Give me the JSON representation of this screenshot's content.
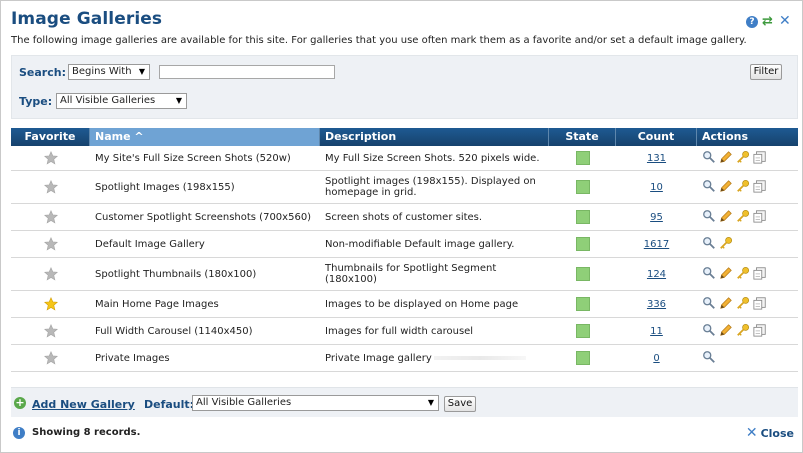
{
  "header": {
    "title": "Image Galleries",
    "subtitle": "The following image galleries are available for this site. For galleries that you use often mark them as a favorite and/or set a default image gallery.",
    "help_icon": "help-icon",
    "refresh_icon": "refresh-icon",
    "close_icon": "close-icon"
  },
  "filters": {
    "search_label": "Search:",
    "search_mode": "Begins With",
    "search_value": "",
    "type_label": "Type:",
    "type_value": "All Visible Galleries",
    "filter_button": "Filter"
  },
  "table": {
    "columns": [
      "Favorite",
      "Name ^",
      "Description",
      "State",
      "Count",
      "Actions"
    ],
    "rows": [
      {
        "favorite": false,
        "name": "My Site's Full Size Screen Shots (520w)",
        "description": "My Full Size Screen Shots. 520 pixels wide.",
        "state": "active",
        "count": "131",
        "actions": [
          "view",
          "edit",
          "key",
          "copy"
        ]
      },
      {
        "favorite": false,
        "name": "Spotlight Images (198x155)",
        "description": "Spotlight images (198x155). Displayed on homepage in grid.",
        "state": "active",
        "count": "10",
        "actions": [
          "view",
          "edit",
          "key",
          "copy"
        ]
      },
      {
        "favorite": false,
        "name": "Customer Spotlight Screenshots (700x560)",
        "description": "Screen shots of customer sites.",
        "state": "active",
        "count": "95",
        "actions": [
          "view",
          "edit",
          "key",
          "copy"
        ]
      },
      {
        "favorite": false,
        "name": "Default Image Gallery",
        "description": "Non-modifiable Default image gallery.",
        "state": "active",
        "count": "1617",
        "actions": [
          "view",
          "key"
        ]
      },
      {
        "favorite": false,
        "name": "Spotlight Thumbnails (180x100)",
        "description": "Thumbnails for Spotlight Segment (180x100)",
        "state": "active",
        "count": "124",
        "actions": [
          "view",
          "edit",
          "key",
          "copy"
        ]
      },
      {
        "favorite": true,
        "name": "Main Home Page Images",
        "description": "Images to be displayed on Home page",
        "state": "active",
        "count": "336",
        "actions": [
          "view",
          "edit",
          "key",
          "copy"
        ]
      },
      {
        "favorite": false,
        "name": "Full Width Carousel (1140x450)",
        "description": "Images for full width carousel",
        "state": "active",
        "count": "11",
        "actions": [
          "view",
          "edit",
          "key",
          "copy"
        ]
      },
      {
        "favorite": false,
        "name": "Private Images",
        "description": "Private Image gallery",
        "state": "active",
        "count": "0",
        "actions": [
          "view"
        ]
      }
    ]
  },
  "footer": {
    "add_gallery": "Add New Gallery",
    "default_label": "Default:",
    "default_value": "All Visible Galleries",
    "save_button": "Save",
    "records": "Showing 8 records.",
    "close_label": "Close"
  },
  "colors": {
    "header_blue": "#1a4d80",
    "grid_header": "#1e5a92",
    "state_green": "#8fcf78",
    "star_gold": "#f5c518",
    "star_gray": "#b8b8b8"
  }
}
